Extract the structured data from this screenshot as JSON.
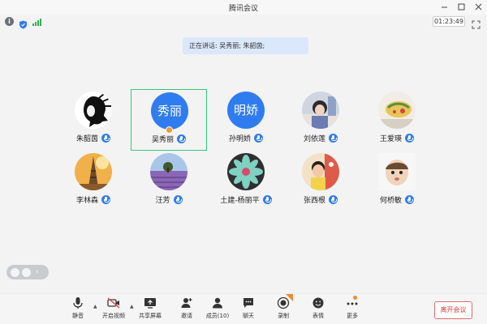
{
  "window": {
    "title": "腾讯会议"
  },
  "status": {
    "timer": "01:23:49"
  },
  "speaking": {
    "text": "正在讲话: 吴秀丽; 朱韶茵;"
  },
  "participants": [
    {
      "name": "朱韶茵",
      "avatar": "photo",
      "avatar_text": ""
    },
    {
      "name": "吴秀丽",
      "avatar": "text",
      "avatar_text": "秀丽",
      "active": true,
      "host": true
    },
    {
      "name": "孙明娇",
      "avatar": "text",
      "avatar_text": "明娇"
    },
    {
      "name": "刘依莲",
      "avatar": "photo",
      "avatar_text": ""
    },
    {
      "name": "王爱瑛",
      "avatar": "photo",
      "avatar_text": ""
    },
    {
      "name": "李林森",
      "avatar": "photo",
      "avatar_text": ""
    },
    {
      "name": "汪芳",
      "avatar": "photo",
      "avatar_text": ""
    },
    {
      "name": "土建-杨丽平",
      "avatar": "photo",
      "avatar_text": ""
    },
    {
      "name": "张西根",
      "avatar": "photo",
      "avatar_text": ""
    },
    {
      "name": "何桥敏",
      "avatar": "photo",
      "avatar_text": ""
    }
  ],
  "toolbar": {
    "mute": "静音",
    "video": "开启视频",
    "share": "共享屏幕",
    "invite": "邀请",
    "members": "成员(10)",
    "chat": "聊天",
    "record": "录制",
    "reaction": "表情",
    "more": "更多",
    "leave": "离开会议"
  },
  "colors": {
    "accent": "#2f7cf0",
    "active_border": "#38c878",
    "leave": "#d83a3a",
    "signal": "#2fb14e"
  }
}
